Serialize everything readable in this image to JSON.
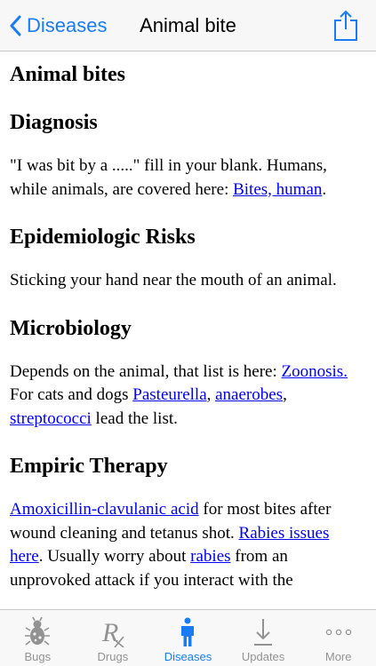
{
  "navbar": {
    "back_label": "Diseases",
    "title": "Animal bite"
  },
  "content": {
    "page_heading": "Animal bites",
    "sections": {
      "diagnosis": {
        "heading": "Diagnosis",
        "text_1": "\"I was bit by a .....\" fill in your blank. Humans, while animals, are covered here: ",
        "link_1": "Bites, human",
        "text_2": "."
      },
      "epidemiologic": {
        "heading": "Epidemiologic Risks",
        "text": "Sticking your hand near the mouth of an animal."
      },
      "microbiology": {
        "heading": "Microbiology",
        "text_1": "Depends on the animal, that list is here: ",
        "link_zoonosis": "Zoonosis.",
        "text_2": " For cats and dogs ",
        "link_pasteurella": "Pasteurella",
        "text_3": ", ",
        "link_anaerobes": "anaerobes",
        "text_4": ", ",
        "link_streptococci": "streptococci",
        "text_5": " lead the list."
      },
      "empiric": {
        "heading": "Empiric Therapy",
        "link_amox": "Amoxicillin-clavulanic acid",
        "text_1": " for most bites after wound cleaning and tetanus shot. ",
        "link_rabies_issues": "Rabies issues here",
        "text_2": ". Usually worry about ",
        "link_rabies": "rabies",
        "text_3": " from an unprovoked attack if you interact with the"
      }
    }
  },
  "tabbar": {
    "tabs": [
      {
        "label": "Bugs",
        "icon": "bug-icon"
      },
      {
        "label": "Drugs",
        "icon": "rx-icon"
      },
      {
        "label": "Diseases",
        "icon": "person-icon",
        "active": true
      },
      {
        "label": "Updates",
        "icon": "download-icon"
      },
      {
        "label": "More",
        "icon": "more-icon"
      }
    ]
  },
  "colors": {
    "accent": "#1a7cf5",
    "link": "#0000ee",
    "tab_inactive": "#929292"
  }
}
